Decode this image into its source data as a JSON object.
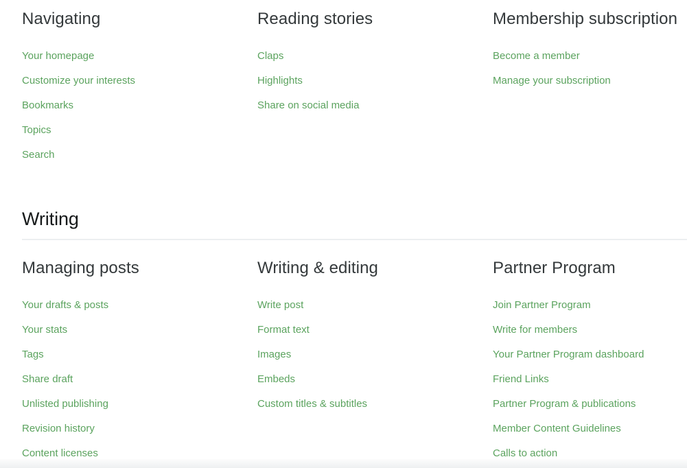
{
  "theme": {
    "link_color": "#5ba35e",
    "heading_color": "#34393b",
    "section_title_color": "#16191a",
    "rule_color": "#eceff0",
    "background": "#ffffff"
  },
  "sections": [
    {
      "id": "reading",
      "title": null,
      "columns": [
        {
          "heading": "Navigating",
          "links": [
            "Your homepage",
            "Customize your interests",
            "Bookmarks",
            "Topics",
            "Search"
          ]
        },
        {
          "heading": "Reading stories",
          "links": [
            "Claps",
            "Highlights",
            "Share on social media"
          ]
        },
        {
          "heading": "Membership subscription",
          "links": [
            "Become a member",
            "Manage your subscription"
          ]
        }
      ]
    },
    {
      "id": "writing",
      "title": "Writing",
      "columns": [
        {
          "heading": "Managing posts",
          "links": [
            "Your drafts & posts",
            "Your stats",
            "Tags",
            "Share draft",
            "Unlisted publishing",
            "Revision history",
            "Content licenses"
          ]
        },
        {
          "heading": "Writing & editing",
          "links": [
            "Write post",
            "Format text",
            "Images",
            "Embeds",
            "Custom titles & subtitles"
          ]
        },
        {
          "heading": "Partner Program",
          "links": [
            "Join Partner Program",
            "Write for members",
            "Your Partner Program dashboard",
            "Friend Links",
            "Partner Program & publications",
            "Member Content Guidelines",
            "Calls to action"
          ]
        }
      ]
    }
  ]
}
